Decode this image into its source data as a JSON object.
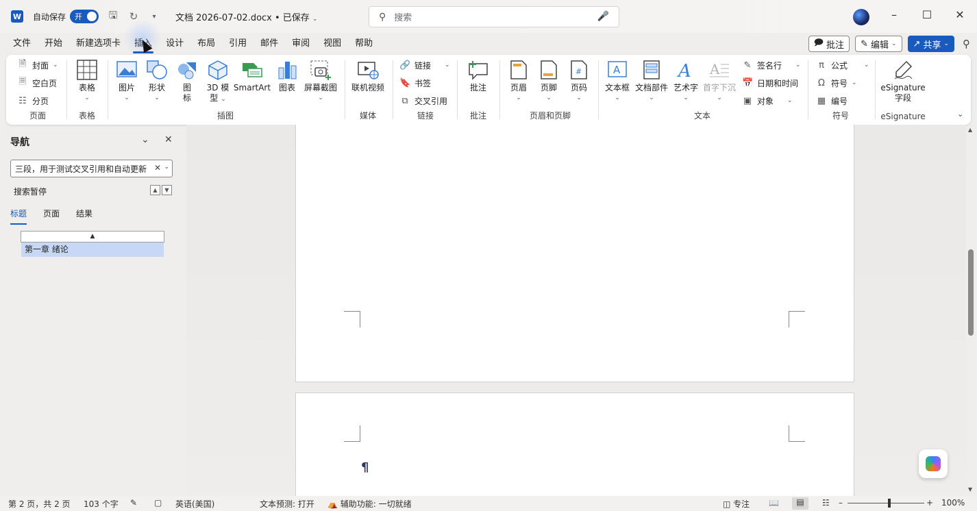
{
  "titlebar": {
    "app_icon": "W",
    "autosave_label": "自动保存",
    "autosave_state": "开",
    "doc_title": "文档 2026-07-02.docx • 已保存",
    "search_placeholder": "搜索",
    "icons": [
      "save-icon",
      "redo-icon",
      "customize-icon"
    ]
  },
  "menu": {
    "tabs": [
      "文件",
      "开始",
      "新建选项卡",
      "插入",
      "设计",
      "布局",
      "引用",
      "邮件",
      "审阅",
      "视图",
      "帮助"
    ],
    "active_tab": "插入",
    "comments_label": "批注",
    "editing_label": "编辑",
    "share_label": "共享"
  },
  "ribbon": {
    "pages": {
      "cover": "封面",
      "blank": "空白页",
      "break": "分页",
      "label": "页面"
    },
    "tables": {
      "table": "表格",
      "label": "表格"
    },
    "illustrations": {
      "picture": "图片",
      "shapes": "形状",
      "icons_l1": "图",
      "icons_l2": "标",
      "model_l1": "3D 模",
      "model_l2": "型",
      "smartart": "SmartArt",
      "chart": "图表",
      "screenshot": "屏幕截图",
      "label": "插图"
    },
    "media": {
      "video": "联机视频",
      "label": "媒体"
    },
    "links": {
      "link": "链接",
      "bookmark": "书签",
      "crossref": "交叉引用",
      "label": "链接"
    },
    "comments": {
      "comment": "批注",
      "label": "批注"
    },
    "header_footer": {
      "header": "页眉",
      "footer": "页脚",
      "pagenum": "页码",
      "label": "页眉和页脚"
    },
    "text": {
      "textbox": "文本框",
      "quickparts": "文档部件",
      "wordart": "艺术字",
      "dropcap": "首字下沉",
      "sigline": "签名行",
      "datetime": "日期和时间",
      "object": "对象",
      "label": "文本"
    },
    "symbols": {
      "equation": "公式",
      "symbol": "符号",
      "number": "编号",
      "label": "符号"
    },
    "esig": {
      "field_l1": "eSignature",
      "field_l2": "字段",
      "label": "eSignature"
    }
  },
  "nav": {
    "title": "导航",
    "search_value": "三段，用于测试交叉引用和自动更新",
    "status": "搜索暂停",
    "tabs": [
      "标题",
      "页面",
      "结果"
    ],
    "active_tab": "标题",
    "headings": [
      "第一章 绪论"
    ]
  },
  "statusbar": {
    "page": "第 2 页，共 2 页",
    "words": "103 个字",
    "language": "英语(美国)",
    "prediction": "文本预测: 打开",
    "accessibility": "辅助功能: 一切就绪",
    "focus": "专注",
    "zoom": "100%"
  },
  "colors": {
    "accent": "#185abd",
    "heading_highlight": "#c6d8f5"
  }
}
